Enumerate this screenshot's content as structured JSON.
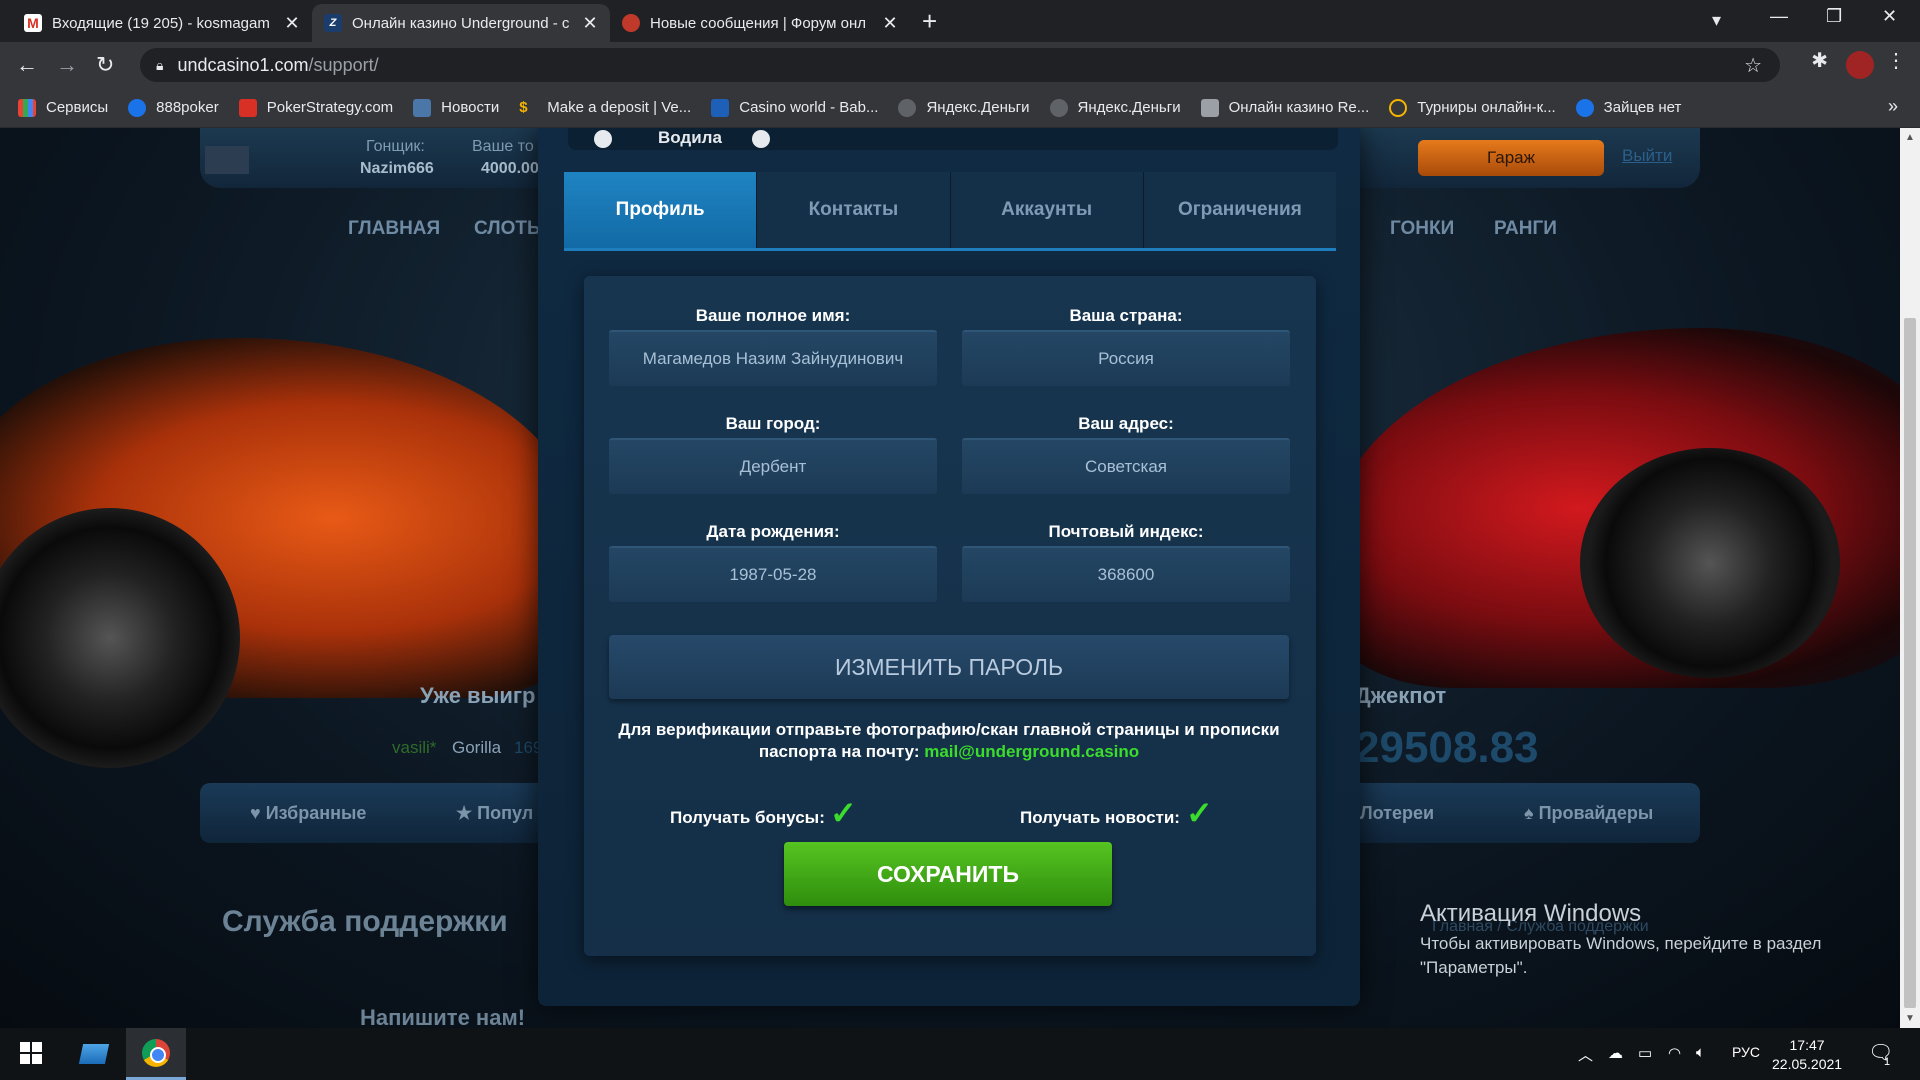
{
  "browser": {
    "tabs": [
      {
        "title": "Входящие (19 205) - kosmagam",
        "active": false
      },
      {
        "title": "Онлайн казино Underground - с",
        "active": true
      },
      {
        "title": "Новые сообщения | Форум онл",
        "active": false
      }
    ],
    "url_domain": "undcasino1.com",
    "url_path": "/support/",
    "bookmarks": [
      "Сервисы",
      "888poker",
      "PokerStrategy.com",
      "Новости",
      "Make a deposit | Ve...",
      "Casino world - Bab...",
      "Яндекс.Деньги",
      "Яндекс.Деньги",
      "Онлайн казино Re...",
      "Турниры онлайн-к...",
      "Зайцев нет"
    ]
  },
  "background_site": {
    "racer_label": "Гонщик:",
    "racer_name": "Nazim666",
    "balance_label": "Ваше то",
    "balance_value": "4000.00",
    "garage": "Гараж",
    "exit": "Выйти",
    "nav": [
      "ГЛАВНАЯ",
      "СЛОТЫ",
      "ГОНКИ",
      "РАНГИ"
    ],
    "won_title": "Уже выигр",
    "jackpot_title": "Джекпот",
    "jackpot_value": "29508.83",
    "winners": [
      "vasili*",
      "Gorilla",
      "169"
    ],
    "categories": [
      "Избранные",
      "Попул",
      "Лотереи",
      "Провайдеры"
    ],
    "support_title": "Служба поддержки",
    "breadcrumb": "Главная / Служба поддержки",
    "write_us": "Напишите нам!"
  },
  "modal": {
    "radio_label": "Водила",
    "tabs": [
      "Профиль",
      "Контакты",
      "Аккаунты",
      "Ограничения"
    ],
    "fields": {
      "full_name": {
        "label": "Ваше полное имя:",
        "value": "Магамедов Назим Зайнудинович"
      },
      "country": {
        "label": "Ваша страна:",
        "value": "Россия"
      },
      "city": {
        "label": "Ваш город:",
        "value": "Дербент"
      },
      "address": {
        "label": "Ваш адрес:",
        "value": "Советская"
      },
      "birthdate": {
        "label": "Дата рождения:",
        "value": "1987-05-28"
      },
      "zip": {
        "label": "Почтовый индекс:",
        "value": "368600"
      }
    },
    "change_password": "ИЗМЕНИТЬ ПАРОЛЬ",
    "verification_text": "Для верификации отправьте фотографию/скан главной страницы и прописки паспорта на почту:",
    "verification_email": "mail@underground.casino",
    "bonuses_label": "Получать бонусы:",
    "news_label": "Получать новости:",
    "checkmark": "✓",
    "save": "СОХРАНИТЬ"
  },
  "windows_activation": {
    "title": "Активация Windows",
    "text1": "Чтобы активировать Windows, перейдите в раздел",
    "text2": "\"Параметры\"."
  },
  "taskbar": {
    "lang": "РУС",
    "time": "17:47",
    "date": "22.05.2021",
    "notifications": "1"
  }
}
